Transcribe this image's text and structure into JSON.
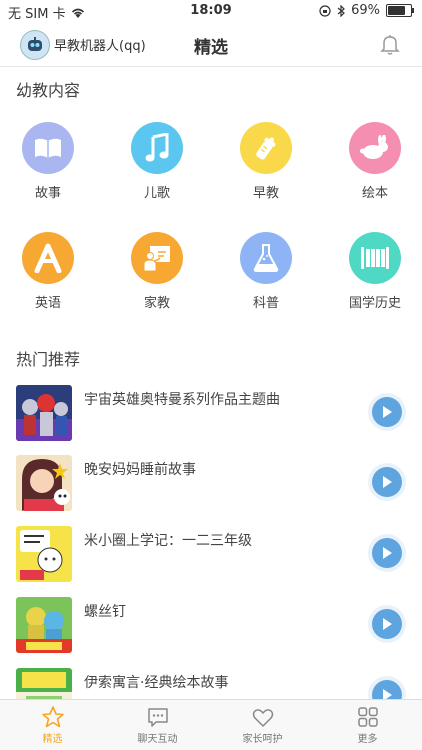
{
  "status": {
    "carrier": "无 SIM 卡",
    "time": "18:09",
    "battery": "69%"
  },
  "nav": {
    "robot_name": "早教机器人(qq)",
    "title": "精选"
  },
  "section_kids": "幼教内容",
  "categories": [
    {
      "label": "故事",
      "color": "#a9b6f0",
      "icon": "book-icon"
    },
    {
      "label": "儿歌",
      "color": "#5bc6f0",
      "icon": "music-note-icon"
    },
    {
      "label": "早教",
      "color": "#f9d84a",
      "icon": "baby-bottle-icon"
    },
    {
      "label": "绘本",
      "color": "#f48fb1",
      "icon": "rabbit-icon"
    },
    {
      "label": "英语",
      "color": "#f7a832",
      "icon": "letter-a-icon"
    },
    {
      "label": "家教",
      "color": "#f7a832",
      "icon": "teacher-board-icon"
    },
    {
      "label": "科普",
      "color": "#8fb4f5",
      "icon": "flask-icon"
    },
    {
      "label": "国学历史",
      "color": "#4fd8c4",
      "icon": "scroll-icon"
    }
  ],
  "section_hot": "热门推荐",
  "hot_items": [
    {
      "title": "宇宙英雄奥特曼系列作品主题曲"
    },
    {
      "title": "晚安妈妈睡前故事"
    },
    {
      "title": "米小圈上学记：一二三年级"
    },
    {
      "title": "螺丝钉"
    },
    {
      "title": "伊索寓言·经典绘本故事"
    }
  ],
  "tabs": [
    {
      "label": "精选",
      "icon": "star-icon"
    },
    {
      "label": "聊天互动",
      "icon": "chat-icon"
    },
    {
      "label": "家长呵护",
      "icon": "heart-icon"
    },
    {
      "label": "更多",
      "icon": "grid-icon"
    }
  ]
}
